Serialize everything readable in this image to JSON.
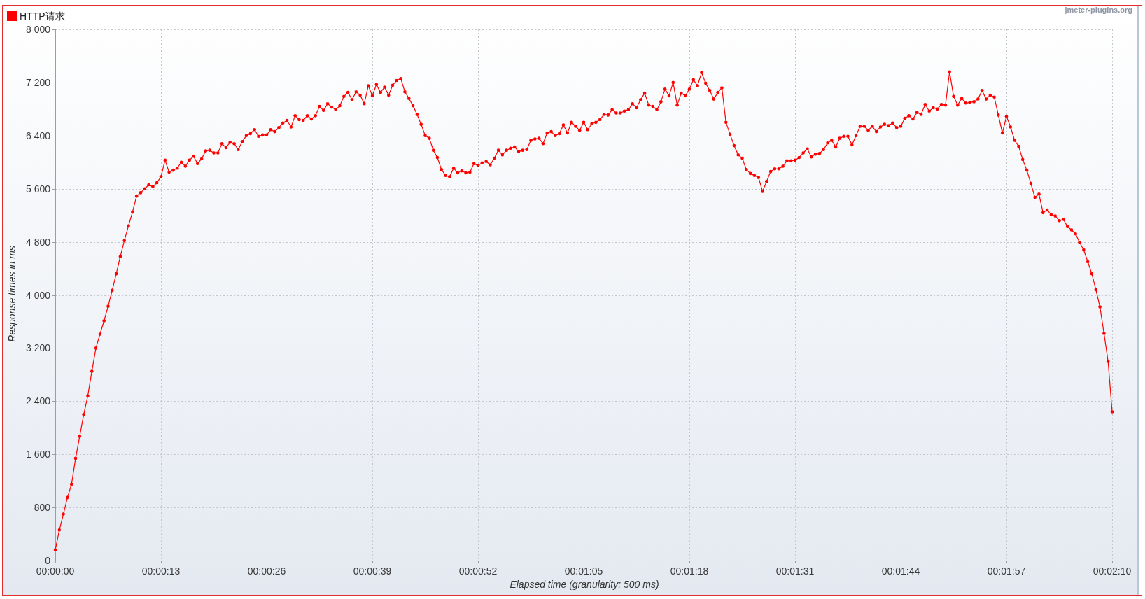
{
  "chart": {
    "branding": "jmeter-plugins.org",
    "chart_data": {
      "type": "line",
      "grid": true,
      "xlabel": "Elapsed time (granularity: 500 ms)",
      "ylabel": "Response times in ms",
      "x": [
        0,
        0.5,
        1,
        1.5,
        2,
        2.5,
        3,
        3.5,
        4,
        4.5,
        5,
        5.5,
        6,
        6.5,
        7,
        7.5,
        8,
        8.5,
        9,
        9.5,
        10,
        10.5,
        11,
        11.5,
        12,
        12.5,
        13,
        13.5,
        14,
        14.5,
        15,
        15.5,
        16,
        16.5,
        17,
        17.5,
        18,
        18.5,
        19,
        19.5,
        20,
        20.5,
        21,
        21.5,
        22,
        22.5,
        23,
        23.5,
        24,
        24.5,
        25,
        25.5,
        26,
        26.5,
        27,
        27.5,
        28,
        28.5,
        29,
        29.5,
        30,
        30.5,
        31,
        31.5,
        32,
        32.5,
        33,
        33.5,
        34,
        34.5,
        35,
        35.5,
        36,
        36.5,
        37,
        37.5,
        38,
        38.5,
        39,
        39.5,
        40,
        40.5,
        41,
        41.5,
        42,
        42.5,
        43,
        43.5,
        44,
        44.5,
        45,
        45.5,
        46,
        46.5,
        47,
        47.5,
        48,
        48.5,
        49,
        49.5,
        50,
        50.5,
        51,
        51.5,
        52,
        52.5,
        53,
        53.5,
        54,
        54.5,
        55,
        55.5,
        56,
        56.5,
        57,
        57.5,
        58,
        58.5,
        59,
        59.5,
        60,
        60.5,
        61,
        61.5,
        62,
        62.5,
        63,
        63.5,
        64,
        64.5,
        65,
        65.5,
        66,
        66.5,
        67,
        67.5,
        68,
        68.5,
        69,
        69.5,
        70,
        70.5,
        71,
        71.5,
        72,
        72.5,
        73,
        73.5,
        74,
        74.5,
        75,
        75.5,
        76,
        76.5,
        77,
        77.5,
        78,
        78.5,
        79,
        79.5,
        80,
        80.5,
        81,
        81.5,
        82,
        82.5,
        83,
        83.5,
        84,
        84.5,
        85,
        85.5,
        86,
        86.5,
        87,
        87.5,
        88,
        88.5,
        89,
        89.5,
        90,
        90.5,
        91,
        91.5,
        92,
        92.5,
        93,
        93.5,
        94,
        94.5,
        95,
        95.5,
        96,
        96.5,
        97,
        97.5,
        98,
        98.5,
        99,
        99.5,
        100,
        100.5,
        101,
        101.5,
        102,
        102.5,
        103,
        103.5,
        104,
        104.5,
        105,
        105.5,
        106,
        106.5,
        107,
        107.5,
        108,
        108.5,
        109,
        109.5,
        110,
        110.5,
        111,
        111.5,
        112,
        112.5,
        113,
        113.5,
        114,
        114.5,
        115,
        115.5,
        116,
        116.5,
        117,
        117.5,
        118,
        118.5,
        119,
        119.5,
        120,
        120.5,
        121,
        121.5,
        122,
        122.5,
        123,
        123.5,
        124,
        124.5,
        125,
        125.5,
        126,
        126.5,
        127,
        127.5,
        128,
        128.5,
        129,
        129.5,
        130
      ],
      "series": [
        {
          "name": "HTTP请求",
          "color": "#ff0000",
          "values": [
            160,
            460,
            700,
            950,
            1150,
            1540,
            1870,
            2200,
            2480,
            2850,
            3200,
            3410,
            3610,
            3830,
            4070,
            4320,
            4580,
            4820,
            5040,
            5250,
            5490,
            5540,
            5600,
            5660,
            5630,
            5690,
            5780,
            6030,
            5850,
            5880,
            5910,
            6000,
            5940,
            6030,
            6090,
            5980,
            6050,
            6170,
            6180,
            6140,
            6140,
            6280,
            6220,
            6300,
            6280,
            6190,
            6310,
            6400,
            6430,
            6490,
            6390,
            6410,
            6410,
            6490,
            6460,
            6520,
            6590,
            6630,
            6530,
            6700,
            6640,
            6630,
            6700,
            6650,
            6700,
            6840,
            6780,
            6880,
            6830,
            6790,
            6850,
            6990,
            7050,
            6940,
            7060,
            7010,
            6880,
            7150,
            7000,
            7170,
            7050,
            7130,
            7010,
            7160,
            7230,
            7260,
            7060,
            6960,
            6850,
            6720,
            6570,
            6400,
            6360,
            6180,
            6070,
            5890,
            5800,
            5780,
            5910,
            5840,
            5870,
            5840,
            5850,
            5980,
            5950,
            5990,
            6010,
            5960,
            6060,
            6180,
            6110,
            6180,
            6210,
            6230,
            6160,
            6180,
            6190,
            6330,
            6350,
            6360,
            6280,
            6440,
            6460,
            6400,
            6430,
            6560,
            6440,
            6600,
            6540,
            6480,
            6600,
            6490,
            6580,
            6600,
            6640,
            6720,
            6710,
            6790,
            6740,
            6740,
            6770,
            6790,
            6880,
            6820,
            6940,
            7040,
            6860,
            6840,
            6790,
            6910,
            7100,
            7000,
            7200,
            6860,
            7040,
            7000,
            7100,
            7240,
            7150,
            7350,
            7190,
            7080,
            6950,
            7050,
            7120,
            6600,
            6420,
            6250,
            6110,
            6060,
            5890,
            5830,
            5800,
            5770,
            5560,
            5710,
            5860,
            5900,
            5900,
            5940,
            6020,
            6020,
            6030,
            6070,
            6140,
            6200,
            6080,
            6120,
            6130,
            6190,
            6290,
            6330,
            6230,
            6360,
            6390,
            6390,
            6260,
            6400,
            6540,
            6540,
            6480,
            6540,
            6460,
            6530,
            6570,
            6550,
            6590,
            6520,
            6540,
            6660,
            6700,
            6650,
            6750,
            6720,
            6870,
            6770,
            6820,
            6800,
            6870,
            6860,
            7360,
            6990,
            6860,
            6960,
            6890,
            6900,
            6910,
            6950,
            7080,
            6950,
            7010,
            6980,
            6710,
            6440,
            6690,
            6530,
            6330,
            6240,
            6040,
            5880,
            5680,
            5470,
            5520,
            5240,
            5280,
            5210,
            5190,
            5120,
            5140,
            5030,
            4980,
            4920,
            4790,
            4680,
            4500,
            4320,
            4080,
            3820,
            3420,
            3000,
            2240
          ]
        }
      ],
      "xlim": [
        0,
        130
      ],
      "ylim": [
        0,
        8000
      ],
      "xticks": [
        {
          "value": 0,
          "label": "00:00:00"
        },
        {
          "value": 13,
          "label": "00:00:13"
        },
        {
          "value": 26,
          "label": "00:00:26"
        },
        {
          "value": 39,
          "label": "00:00:39"
        },
        {
          "value": 52,
          "label": "00:00:52"
        },
        {
          "value": 65,
          "label": "00:01:05"
        },
        {
          "value": 78,
          "label": "00:01:18"
        },
        {
          "value": 91,
          "label": "00:01:31"
        },
        {
          "value": 104,
          "label": "00:01:44"
        },
        {
          "value": 117,
          "label": "00:01:57"
        },
        {
          "value": 130,
          "label": "00:02:10"
        }
      ],
      "yticks": [
        {
          "value": 0,
          "label": "0"
        },
        {
          "value": 800,
          "label": "800"
        },
        {
          "value": 1600,
          "label": "1 600"
        },
        {
          "value": 2400,
          "label": "2 400"
        },
        {
          "value": 3200,
          "label": "3 200"
        },
        {
          "value": 4000,
          "label": "4 000"
        },
        {
          "value": 4800,
          "label": "4 800"
        },
        {
          "value": 5600,
          "label": "5 600"
        },
        {
          "value": 6400,
          "label": "6 400"
        },
        {
          "value": 7200,
          "label": "7 200"
        },
        {
          "value": 8000,
          "label": "8 000"
        }
      ]
    }
  }
}
